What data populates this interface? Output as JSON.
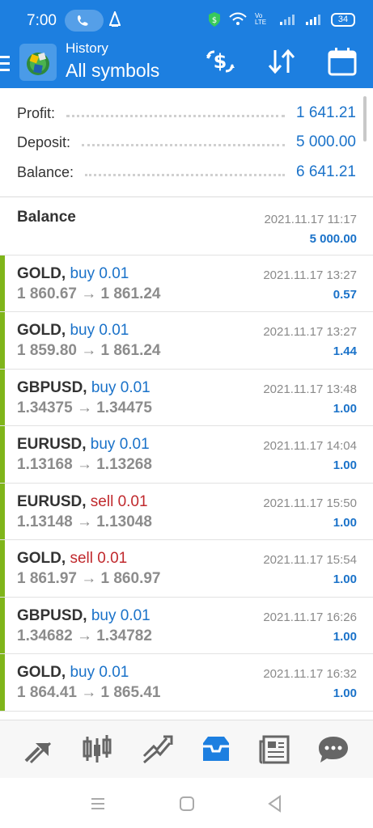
{
  "status_bar": {
    "time": "7:00",
    "battery": "34",
    "network_label": "Vo LTE"
  },
  "header": {
    "title": "History",
    "subtitle": "All symbols",
    "accent_color": "#1d7fe0",
    "actions": [
      "currency-exchange-icon",
      "sort-icon",
      "calendar-icon"
    ]
  },
  "summary": {
    "rows": [
      {
        "label": "Profit:",
        "value": "1 641.21"
      },
      {
        "label": "Deposit:",
        "value": "5 000.00"
      },
      {
        "label": "Balance:",
        "value": "6 641.21"
      }
    ]
  },
  "balance_entry": {
    "title": "Balance",
    "date": "2021.11.17 11:17",
    "amount": "5 000.00"
  },
  "trades": [
    {
      "symbol": "GOLD,",
      "side": "buy 0.01",
      "type": "buy",
      "prices": "1 860.67 → 1 861.24",
      "date": "2021.11.17 13:27",
      "profit": "0.57"
    },
    {
      "symbol": "GOLD,",
      "side": "buy 0.01",
      "type": "buy",
      "prices": "1 859.80 → 1 861.24",
      "date": "2021.11.17 13:27",
      "profit": "1.44"
    },
    {
      "symbol": "GBPUSD,",
      "side": "buy 0.01",
      "type": "buy",
      "prices": "1.34375 → 1.34475",
      "date": "2021.11.17 13:48",
      "profit": "1.00"
    },
    {
      "symbol": "EURUSD,",
      "side": "buy 0.01",
      "type": "buy",
      "prices": "1.13168 → 1.13268",
      "date": "2021.11.17 14:04",
      "profit": "1.00"
    },
    {
      "symbol": "EURUSD,",
      "side": "sell 0.01",
      "type": "sell",
      "prices": "1.13148 → 1.13048",
      "date": "2021.11.17 15:50",
      "profit": "1.00"
    },
    {
      "symbol": "GOLD,",
      "side": "sell 0.01",
      "type": "sell",
      "prices": "1 861.97 → 1 860.97",
      "date": "2021.11.17 15:54",
      "profit": "1.00"
    },
    {
      "symbol": "GBPUSD,",
      "side": "buy 0.01",
      "type": "buy",
      "prices": "1.34682 → 1.34782",
      "date": "2021.11.17 16:26",
      "profit": "1.00"
    },
    {
      "symbol": "GOLD,",
      "side": "buy 0.01",
      "type": "buy",
      "prices": "1 864.41 → 1 865.41",
      "date": "2021.11.17 16:32",
      "profit": "1.00"
    }
  ],
  "bottom_nav": {
    "items": [
      "quotes-icon",
      "chart-icon",
      "trade-icon",
      "history-icon",
      "news-icon",
      "chat-icon"
    ],
    "active": "history-icon",
    "active_color": "#1d7fe0"
  },
  "system_nav": [
    "recent-apps-icon",
    "home-icon",
    "back-icon"
  ]
}
